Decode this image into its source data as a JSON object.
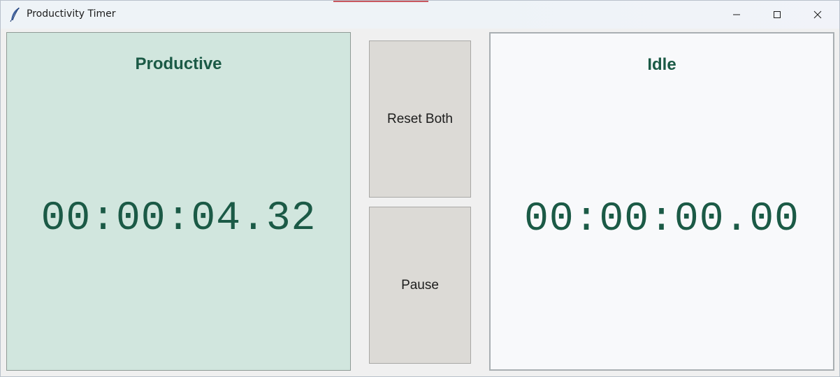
{
  "window": {
    "title": "Productivity Timer",
    "icon": "feather-icon",
    "controls": [
      "minimize-icon",
      "maximize-icon",
      "close-icon"
    ]
  },
  "productive": {
    "label": "Productive",
    "time": "00:00:04.32",
    "background": "#d1e6de",
    "text_color": "#1b5a46"
  },
  "idle": {
    "label": "Idle",
    "time": "00:00:00.00",
    "background": "#f8f9fb",
    "text_color": "#1b5a46"
  },
  "controls": {
    "reset_label": "Reset Both",
    "pause_label": "Pause",
    "button_color": "#dcdad6"
  }
}
